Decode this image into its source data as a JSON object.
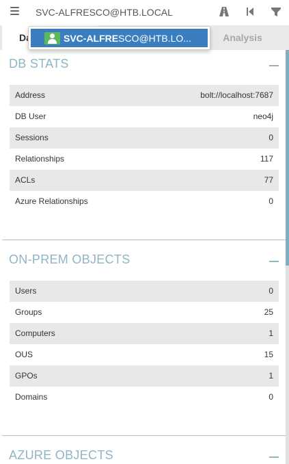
{
  "search": {
    "value": "SVC-ALFRESCO@HTB.LOCAL"
  },
  "autocomplete": {
    "match": "SVC-ALFRE",
    "rest": "SCO@HTB.LO..."
  },
  "tabs": {
    "database": "Da",
    "analysis": "Analysis"
  },
  "icons": {
    "menu": "hamburger-icon",
    "pathfinding": "road-icon",
    "back": "back-icon",
    "filter": "filter-icon",
    "user": "user-icon",
    "collapse": "minus-icon"
  },
  "colors": {
    "accent": "#3a7ebf",
    "user_icon": "#5cb85c",
    "section_title": "#8fb4c6"
  },
  "db_stats": {
    "title": "DB STATS",
    "rows": [
      {
        "label": "Address",
        "value": "bolt://localhost:7687"
      },
      {
        "label": "DB User",
        "value": "neo4j"
      },
      {
        "label": "Sessions",
        "value": "0"
      },
      {
        "label": "Relationships",
        "value": "117"
      },
      {
        "label": "ACLs",
        "value": "77"
      },
      {
        "label": "Azure Relationships",
        "value": "0"
      }
    ]
  },
  "onprem": {
    "title": "ON-PREM OBJECTS",
    "rows": [
      {
        "label": "Users",
        "value": "0"
      },
      {
        "label": "Groups",
        "value": "25"
      },
      {
        "label": "Computers",
        "value": "1"
      },
      {
        "label": "OUS",
        "value": "15"
      },
      {
        "label": "GPOs",
        "value": "1"
      },
      {
        "label": "Domains",
        "value": "0"
      }
    ]
  },
  "azure": {
    "title": "AZURE OBJECTS"
  }
}
